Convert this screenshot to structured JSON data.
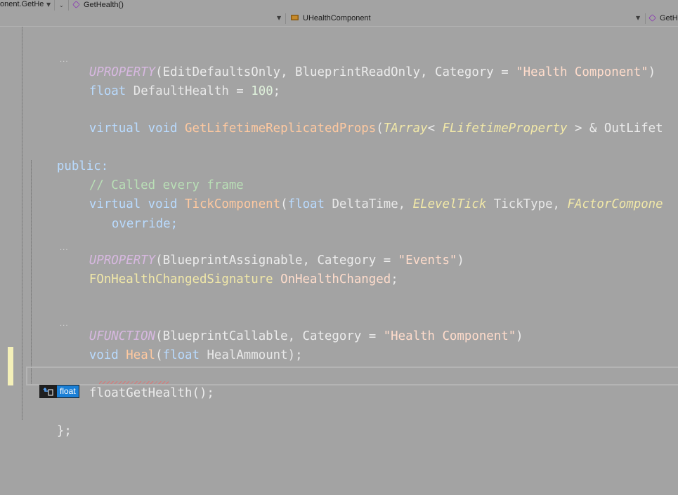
{
  "navigation": {
    "project_combo": "onent.GetHe",
    "member_combo": "GetHealth()",
    "class_combo": "UHealthComponent",
    "right_combo": "GetH"
  },
  "code": {
    "line_uproperty_1_macro": "UPROPERTY",
    "line_uproperty_1_args_a": "(EditDefaultsOnly, BlueprintReadOnly, Category = ",
    "line_uproperty_1_str": "\"Health Component\"",
    "line_uproperty_1_close": ")",
    "line_default_kw": "float",
    "line_default_name": " DefaultHealth = ",
    "line_default_num": "100",
    "line_default_end": ";",
    "line_lifetime_kw": "virtual void ",
    "line_lifetime_fn": "GetLifetimeReplicatedProps",
    "line_lifetime_p1": "(",
    "line_lifetime_type1": "TArray",
    "line_lifetime_p2": "< ",
    "line_lifetime_type2": "FLifetimeProperty",
    "line_lifetime_p3": " > & OutLifet",
    "line_public": "public:",
    "line_comment": "// Called every frame",
    "line_tick_kw": "virtual void ",
    "line_tick_fn": "TickComponent",
    "line_tick_p1": "(",
    "line_tick_float": "float",
    "line_tick_p2": " DeltaTime, ",
    "line_tick_type1": "ELevelTick",
    "line_tick_p3": " TickType, ",
    "line_tick_type2": "FActorCompone",
    "line_override": "override;",
    "line_uproperty_2_macro": "UPROPERTY",
    "line_uproperty_2_args": "(BlueprintAssignable, Category = ",
    "line_uproperty_2_str": "\"Events\"",
    "line_uproperty_2_close": ")",
    "line_delegate_type": "FOnHealthChangedSignature",
    "line_delegate_name": " OnHealthChanged",
    "line_delegate_end": ";",
    "line_ufunction_macro": "UFUNCTION",
    "line_ufunction_args": "(BlueprintCallable, Category = ",
    "line_ufunction_str": "\"Health Component\"",
    "line_ufunction_close": ")",
    "line_heal_kw": "void ",
    "line_heal_fn": "Heal",
    "line_heal_p1": "(",
    "line_heal_float": "float",
    "line_heal_p2": " HealAmmount);",
    "line_gethealth_kw": "float",
    "line_gethealth_fn": "GetHealth",
    "line_gethealth_end": "();",
    "line_close": "};"
  },
  "tooltip": {
    "text": "float",
    "icon": "quick-action-lightbulb-icon"
  },
  "colors": {
    "background": "#a3a3a3",
    "macro": "#d7b8e0",
    "keyword": "#b9dbff",
    "type": "#f1e8a8",
    "function": "#ffc9a0",
    "string": "#ffdccb",
    "comment": "#b9dfb6",
    "tooltip_bg": "#1a7fd6",
    "change_marker": "#f4f0b8"
  }
}
